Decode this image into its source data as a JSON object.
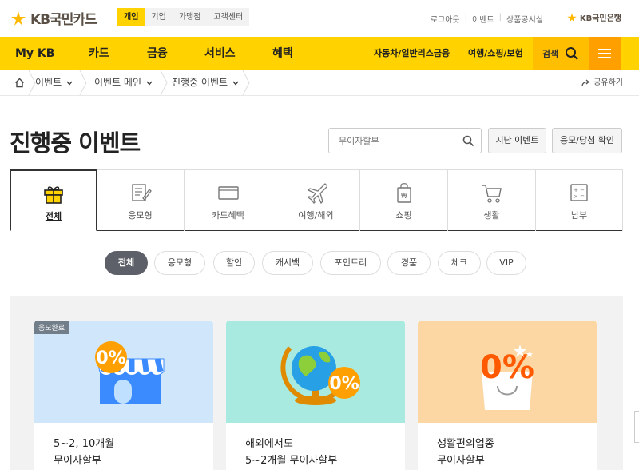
{
  "header": {
    "logo_text": "KB국민카드",
    "segment_tabs": [
      "개인",
      "기업",
      "가맹점",
      "고객센터"
    ],
    "util_links": [
      "로그아웃",
      "이벤트",
      "상품공시실"
    ],
    "bank_link": "KB국민은행",
    "brand_color": "#ffd200"
  },
  "gnb": {
    "items": [
      "My KB",
      "카드",
      "금융",
      "서비스",
      "혜택"
    ],
    "sub_items": [
      "자동차/일반리스금융",
      "여행/쇼핑/보험"
    ],
    "search_label": "검색"
  },
  "breadcrumb": {
    "items": [
      "이벤트",
      "이벤트 메인",
      "진행중 이벤트"
    ],
    "share_label": "공유하기"
  },
  "page": {
    "title": "진행중 이벤트",
    "search_placeholder": "무이자할부",
    "past_events_label": "지난 이벤트",
    "entry_check_label": "응모/당첨 확인"
  },
  "categories": [
    {
      "label": "전체",
      "icon": "gift-icon",
      "active": true
    },
    {
      "label": "응모형",
      "icon": "form-pen-icon"
    },
    {
      "label": "카드혜택",
      "icon": "card-icon"
    },
    {
      "label": "여행/해외",
      "icon": "airplane-icon"
    },
    {
      "label": "쇼핑",
      "icon": "shopping-bag-icon"
    },
    {
      "label": "생활",
      "icon": "cart-icon"
    },
    {
      "label": "납부",
      "icon": "calculator-icon"
    }
  ],
  "filters": [
    "전체",
    "응모형",
    "할인",
    "캐시백",
    "포인트리",
    "경품",
    "체크",
    "VIP"
  ],
  "cards": [
    {
      "badge": "응모완료",
      "title": "5~2, 10개월\n무이자할부",
      "bg": "#cfe6fb"
    },
    {
      "title": "해외에서도\n5~2개월 무이자할부",
      "bg": "#a8eadf"
    },
    {
      "title": "생활편의업종\n무이자할부",
      "bg": "#fcd7a4"
    }
  ],
  "badges_text": [
    "0%",
    "0%",
    "0%"
  ]
}
